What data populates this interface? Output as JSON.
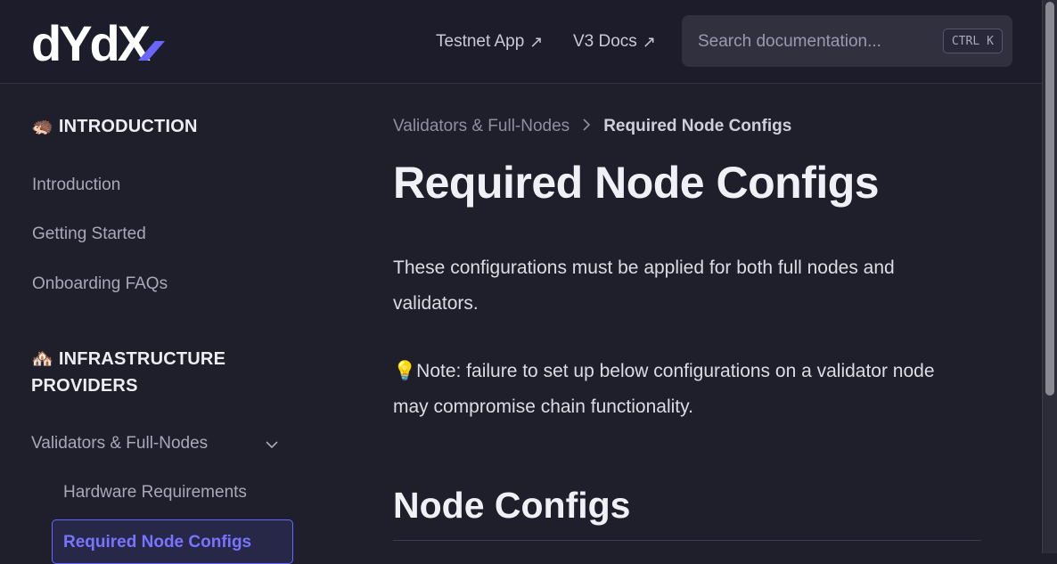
{
  "header": {
    "logo_alt": "dYdX",
    "links": [
      {
        "label": "Testnet App",
        "icon": "external-arrow-icon"
      },
      {
        "label": "V3 Docs",
        "icon": "external-arrow-icon"
      }
    ],
    "search": {
      "placeholder": "Search documentation...",
      "shortcut_ctrl": "CTRL",
      "shortcut_key": "K"
    }
  },
  "sidebar": {
    "sections": [
      {
        "emoji": "🦔",
        "title": "INTRODUCTION",
        "items": [
          "Introduction",
          "Getting Started",
          "Onboarding FAQs"
        ]
      },
      {
        "emoji": "🏘️",
        "title_line1": "INFRASTRUCTURE",
        "title_line2": "PROVIDERS",
        "group": "Validators & Full-Nodes",
        "sub_items": [
          "Hardware Requirements",
          "Required Node Configs"
        ]
      }
    ]
  },
  "main": {
    "breadcrumb": [
      "Validators & Full-Nodes",
      "Required Node Configs"
    ],
    "title": "Required Node Configs",
    "intro": "These configurations must be applied for both full nodes and validators.",
    "note_emoji": "💡",
    "note": "Note: failure to set up below configurations on a validator node may compromise chain functionality.",
    "section_heading": "Node Configs"
  },
  "colors": {
    "background": "#1f1f2c",
    "accent": "#7774ff",
    "logo_accent": "#6966ff"
  }
}
